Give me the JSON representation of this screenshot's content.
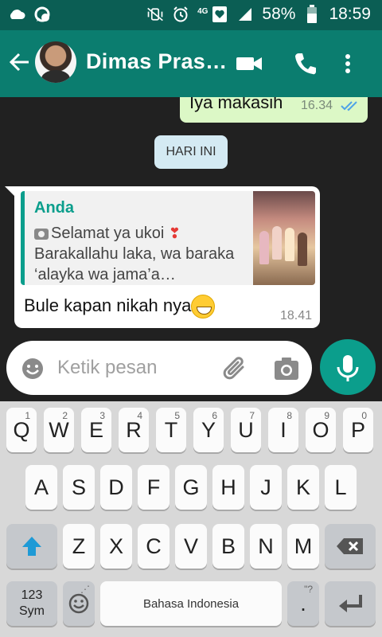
{
  "status_bar": {
    "left_icons": [
      "cloud-icon",
      "whatsapp-notification-icon"
    ],
    "right_icons": [
      "vibrate-mute-icon",
      "alarm-icon",
      "network-4g-icon",
      "heart-notification-icon",
      "signal-icon",
      "battery-icon"
    ],
    "network_type": "4G",
    "battery_percent": "58%",
    "time": "18:59"
  },
  "app_bar": {
    "contact_name": "Dimas Pras…",
    "icons": [
      "back-arrow-icon",
      "video-call-icon",
      "phone-icon",
      "more-vert-icon"
    ]
  },
  "chat": {
    "outgoing": {
      "text": "Iya makasih",
      "time": "16.34",
      "status_icon": "double-check-icon"
    },
    "date_chip": "HARI INI",
    "incoming": {
      "quote": {
        "author": "Anda",
        "line1": "Selamat ya ukoi ",
        "line2": "Barakallahu laka, wa baraka",
        "line3": "‘alayka wa jama’a…"
      },
      "text": "Bule kapan nikah nya",
      "time": "18.41"
    }
  },
  "composer": {
    "placeholder": "Ketik pesan"
  },
  "keyboard": {
    "row1": [
      {
        "key": "Q",
        "hint": "1"
      },
      {
        "key": "W",
        "hint": "2"
      },
      {
        "key": "E",
        "hint": "3"
      },
      {
        "key": "R",
        "hint": "4"
      },
      {
        "key": "T",
        "hint": "5"
      },
      {
        "key": "Y",
        "hint": "6"
      },
      {
        "key": "U",
        "hint": "7"
      },
      {
        "key": "I",
        "hint": "8"
      },
      {
        "key": "O",
        "hint": "9"
      },
      {
        "key": "P",
        "hint": "0"
      }
    ],
    "row2": [
      "A",
      "S",
      "D",
      "F",
      "G",
      "H",
      "J",
      "K",
      "L"
    ],
    "row3": [
      "Z",
      "X",
      "C",
      "V",
      "B",
      "N",
      "M"
    ],
    "symbols_key": {
      "line1": "123",
      "line2": "Sym"
    },
    "space_label": "Bahasa Indonesia",
    "period_key": ".",
    "period_hint": "\"?"
  },
  "colors": {
    "accent": "#0b7d6f",
    "status_bar": "#0b5e54",
    "outgoing_bubble": "#dcf8c6",
    "mic_button": "#0b9e8c"
  }
}
